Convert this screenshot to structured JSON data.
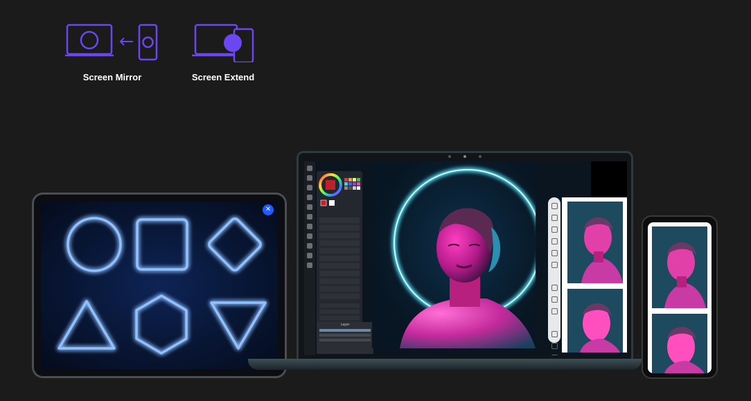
{
  "modes": [
    {
      "label": "Screen Mirror",
      "icon": "screen-mirror-icon"
    },
    {
      "label": "Screen Extend",
      "icon": "screen-extend-icon"
    }
  ],
  "colors": {
    "accent": "#6a47f0",
    "neon_blue": "#6fa8ff",
    "neon_pink": "#ff2fb4",
    "neon_cyan": "#58e8ff",
    "background": "#1b1b1b"
  },
  "tablet": {
    "shapes": [
      "circle",
      "square",
      "diamond",
      "triangle",
      "hexagon",
      "inverted-triangle"
    ],
    "close_icon": "close-icon"
  },
  "laptop": {
    "app": "drawing-app",
    "layer_panel_title": "Layer"
  },
  "phone": {
    "content": "portrait-strip"
  }
}
